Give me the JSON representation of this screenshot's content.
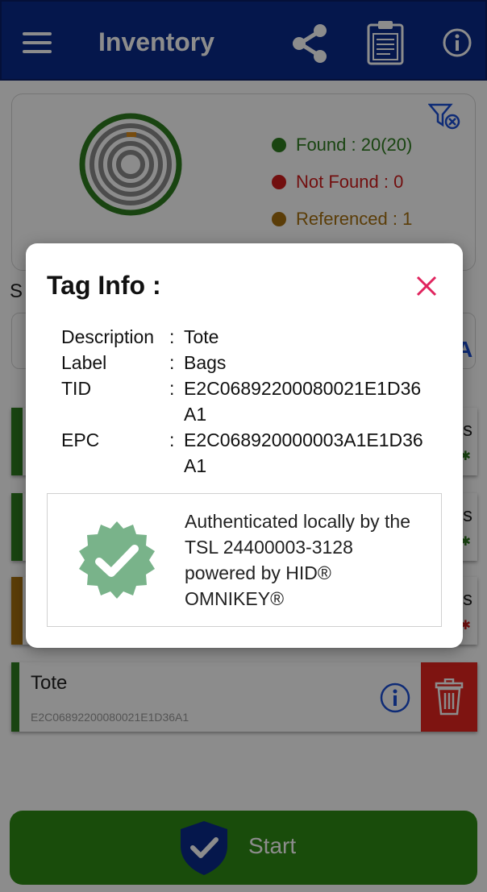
{
  "header": {
    "title": "Inventory",
    "icons": [
      "menu-icon",
      "share-icon",
      "clipboard-icon",
      "info-icon"
    ]
  },
  "summary": {
    "found_label": "Found : 20(20)",
    "not_found_label": "Not Found : 0",
    "referenced_label": "Referenced : 1",
    "colors": {
      "found": "#2e7d1f",
      "not_found": "#d01c1c",
      "referenced": "#a66f10"
    }
  },
  "list": {
    "partial_letter": "S",
    "rows": [
      {
        "status_color": "#2e7d1f",
        "edge_text": "s"
      },
      {
        "status_color": "#2e7d1f",
        "edge_text": "s"
      },
      {
        "status_color": "#a66f10",
        "edge_text": "s"
      }
    ],
    "tote": {
      "name": "Tote",
      "epc": "E2C06892200080021E1D36A1"
    }
  },
  "start_button": {
    "label": "Start"
  },
  "dialog": {
    "title": "Tag Info :",
    "fields": [
      {
        "key": "Description",
        "sep": ":",
        "value": "Tote"
      },
      {
        "key": "Label",
        "sep": ":",
        "value": "Bags"
      },
      {
        "key": "TID",
        "sep": ":",
        "value": "E2C06892200080021E1D36A1"
      },
      {
        "key": "EPC",
        "sep": ":",
        "value": "E2C068920000003A1E1D36A1"
      }
    ],
    "auth_text": "Authenticated locally by the TSL 24400003-3128 powered by HID® OMNIKEY®"
  }
}
